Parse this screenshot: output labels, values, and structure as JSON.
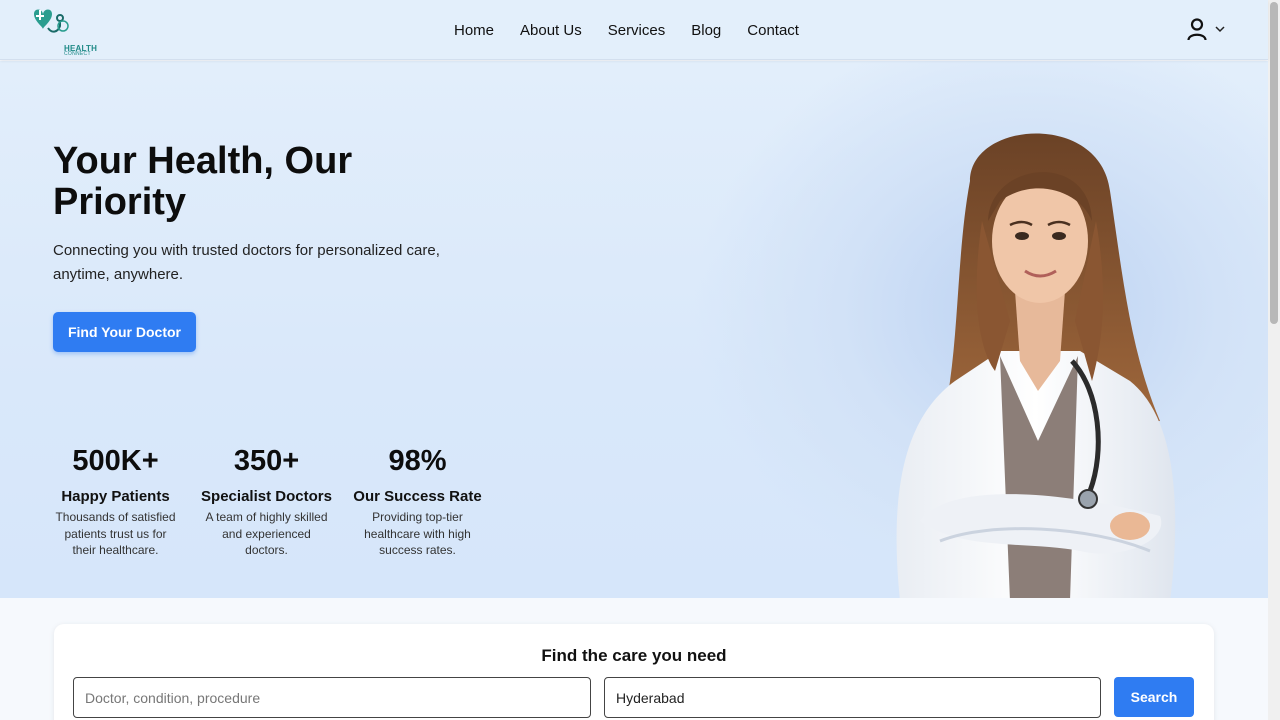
{
  "brand": {
    "name": "HEALTH",
    "sub": "CONNECT",
    "color": "#1f8a87"
  },
  "nav": {
    "links": [
      "Home",
      "About Us",
      "Services",
      "Blog",
      "Contact"
    ],
    "user_icon": "user-icon",
    "dropdown_icon": "chevron-down-icon"
  },
  "hero": {
    "title": "Your Health, Our Priority",
    "subtitle": "Connecting you with trusted doctors for personalized care, anytime, anywhere.",
    "cta_label": "Find Your Doctor",
    "stats": [
      {
        "value": "500K+",
        "label": "Happy Patients",
        "desc": "Thousands of satisfied patients trust us for their healthcare."
      },
      {
        "value": "350+",
        "label": "Specialist Doctors",
        "desc": "A team of highly skilled and experienced doctors."
      },
      {
        "value": "98%",
        "label": "Our Success Rate",
        "desc": "Providing top-tier healthcare with high success rates."
      }
    ]
  },
  "search": {
    "title": "Find the care you need",
    "query_placeholder": "Doctor, condition, procedure",
    "query_value": "",
    "location_value": "Hyderabad",
    "button_label": "Search"
  },
  "colors": {
    "accent": "#2f7cf2",
    "hero_bg": "#dceafa"
  }
}
